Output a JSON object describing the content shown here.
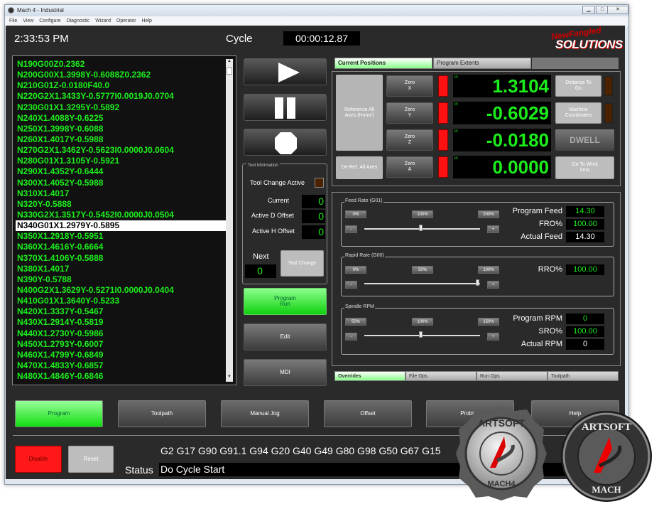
{
  "window": {
    "title": "Mach 4 - Industrial",
    "min": "▁",
    "max": "□",
    "close": "✕"
  },
  "menu": [
    "File",
    "View",
    "Configure",
    "Diagnostic",
    "Wizard",
    "Operator",
    "Help"
  ],
  "header": {
    "time": "2:33:53 PM",
    "cycle_label": "Cycle",
    "cycle_time": "00:00:12.87"
  },
  "logo": {
    "line1": "NewFangled",
    "line2": "SOLUTIONS"
  },
  "gcode": {
    "lines": [
      "N190G00Z0.2362",
      "N200G00X1.3998Y-0.6088Z0.2362",
      "N210G01Z-0.0180F40.0",
      "N220G2X1.3433Y-0.5777I0.0019J0.0704",
      "N230G01X1.3295Y-0.5892",
      "N240X1.4088Y-0.6225",
      "N250X1.3998Y-0.6088",
      "N260X1.4017Y-0.5988",
      "N270G2X1.3462Y-0.5623I0.0000J0.0604",
      "N280G01X1.3105Y-0.5921",
      "N290X1.4352Y-0.6444",
      "N300X1.4052Y-0.5988",
      "N310X1.4017",
      "N320Y-0.5888",
      "N330G2X1.3517Y-0.5452I0.0000J0.0504",
      "N340G01X1.2979Y-0.5895",
      "N350X1.2918Y-0.5951",
      "N360X1.4616Y-0.6664",
      "N370X1.4106Y-0.5888",
      "N380X1.4017",
      "N390Y-0.5788",
      "N400G2X1.3629Y-0.5271I0.0000J0.0404",
      "N410G01X1.3640Y-0.5233",
      "N420X1.3337Y-0.5467",
      "N430X1.2914Y-0.5819",
      "N440X1.2730Y-0.5986",
      "N450X1.2793Y-0.6007",
      "N460X1.4799Y-0.6849",
      "N470X1.4833Y-0.6857",
      "N480X1.4846Y-0.6846"
    ],
    "selected_index": 15
  },
  "tool_info": {
    "title": "Tool Information",
    "tool_change_active": "Tool Change Active",
    "current_label": "Current",
    "current": "0",
    "d_offset_label": "Active D Offset",
    "d_offset": "0",
    "h_offset_label": "Active H Offset",
    "h_offset": "0",
    "next_label": "Next",
    "next": "0",
    "tool_change_btn": "Tool Change"
  },
  "mid_buttons": {
    "program_run": "Program Run",
    "edit": "Edit",
    "mdi": "MDI"
  },
  "pos_tabs": {
    "current": "Current Positions",
    "extents": "Program Extents"
  },
  "positions": {
    "reference_btn": "Reference All Axes (Home)",
    "deref_btn": "De-Ref. All Axes",
    "unit": "in",
    "axes": [
      {
        "zero": "Zero X",
        "value": "1.3104"
      },
      {
        "zero": "Zero Y",
        "value": "-0.6029"
      },
      {
        "zero": "Zero Z",
        "value": "-0.0180"
      },
      {
        "zero": "Zero A",
        "value": "0.0000"
      }
    ],
    "dist_to_go": "Distance To Go",
    "machine_coords": "Machine Coordinates",
    "dwell": "DWELL",
    "goto_zero": "Go To Work Zero"
  },
  "feed": {
    "title": "Feed Rate (G01)",
    "b0": "0%",
    "b100": "100%",
    "b200": "200%",
    "minus": "-",
    "plus": "+",
    "slider_pct": 50,
    "program_feed_label": "Program Feed",
    "program_feed": "14.30",
    "fro_label": "FRO%",
    "fro": "100.00",
    "actual_feed_label": "Actual Feed",
    "actual_feed": "14.30"
  },
  "rapid": {
    "title": "Rapid Rate (G00)",
    "b0": "0%",
    "b50": "50%",
    "b100": "100%",
    "minus": "-",
    "plus": "+",
    "slider_pct": 100,
    "rro_label": "RRO%",
    "rro": "100.00"
  },
  "spindle": {
    "title": "Spindle RPM",
    "b50": "50%",
    "b100": "100%",
    "b150": "150%",
    "minus": "-",
    "plus": "+",
    "slider_pct": 50,
    "program_rpm_label": "Program RPM",
    "program_rpm": "0",
    "sro_label": "SRO%",
    "sro": "100.00",
    "actual_rpm_label": "Actual RPM",
    "actual_rpm": "0"
  },
  "bottom_tabs": [
    "Overrides",
    "File Ops",
    "Run Ops",
    "Toolpath"
  ],
  "nav": [
    "Program",
    "Toolpath",
    "Manual Jog",
    "Offset",
    "Probing",
    "Help"
  ],
  "disable": "Disable",
  "reset": "Reset",
  "gmodes": "G2 G17 G90 G91.1 G94 G20 G40 G49 G80 G98 G50 G67 G15",
  "status_label": "Status",
  "status": "Do Cycle Start",
  "badge1": {
    "top": "ARTSOFT",
    "bottom": "MACH4"
  },
  "badge2": {
    "top": "ARTSOFT",
    "bottom": "MACH"
  },
  "colors": {
    "accent_green": "#1cee1c",
    "led_red": "#ff1111",
    "button_green": "#22dd22"
  }
}
